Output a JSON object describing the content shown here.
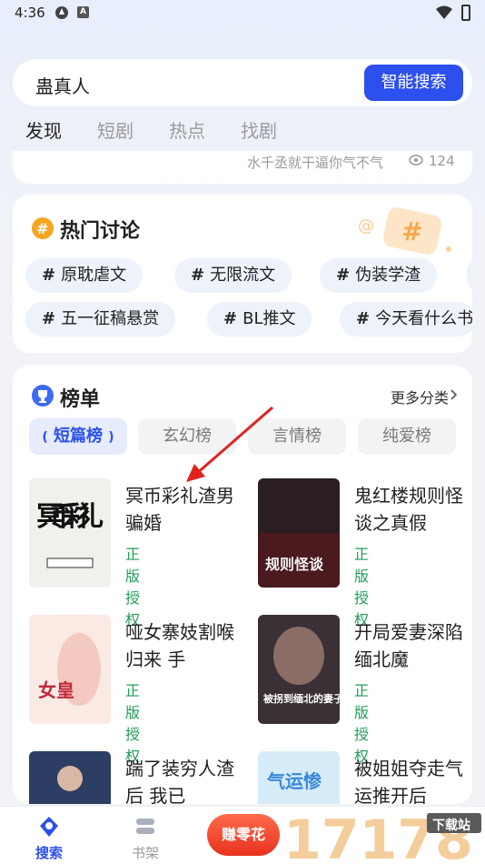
{
  "status_bar": {
    "time": "4:36"
  },
  "search": {
    "query": "蛊真人",
    "button_label": "智能搜索"
  },
  "top_tabs": [
    {
      "label": "发现",
      "active": true
    },
    {
      "label": "短剧",
      "active": false
    },
    {
      "label": "热点",
      "active": false
    },
    {
      "label": "找剧",
      "active": false
    }
  ],
  "previous_card": {
    "text": "水千丞就干逼你气不气",
    "views": "124"
  },
  "discuss": {
    "title": "热门讨论",
    "tags": [
      "原耽虐文",
      "无限流文",
      "伪装学渣",
      "五一征稿悬赏",
      "BL推文",
      "今天看什么书"
    ]
  },
  "ranking": {
    "title": "榜单",
    "more_label": "更多分类",
    "tabs": [
      {
        "label": "短篇榜",
        "active": true
      },
      {
        "label": "玄幻榜",
        "active": false
      },
      {
        "label": "言情榜",
        "active": false
      },
      {
        "label": "纯爱榜",
        "active": false
      }
    ],
    "books": [
      {
        "title": "冥币彩礼渣男骗婚",
        "badge": "正版授权",
        "cover_text": "冥币彩礼"
      },
      {
        "title": "鬼红楼规则怪谈之真假",
        "badge": "正版授权",
        "cover_text": "规则怪谈"
      },
      {
        "title": "哑女寨妓割喉归来 手",
        "badge": "正版授权",
        "cover_text": "女皇"
      },
      {
        "title": "开局爱妻深陷缅北魔",
        "badge": "正版授权",
        "cover_text": "被拐到缅北的妻子"
      },
      {
        "title": "踹了装穷人渣后 我已",
        "badge": "",
        "cover_text": ""
      },
      {
        "title": "被姐姐夺走气运推开后",
        "badge": "",
        "cover_text": "气运惨"
      }
    ]
  },
  "bottom_nav": [
    {
      "label": "搜索",
      "active": true,
      "icon": "search-nav-icon"
    },
    {
      "label": "书架",
      "active": false,
      "icon": "bookshelf-icon"
    },
    {
      "label": "赚零花",
      "active": false,
      "icon": "earn-icon"
    }
  ],
  "watermark": {
    "text": "下载站"
  },
  "colors": {
    "accent": "#2b50ee",
    "badge_green": "#1f9d57"
  }
}
